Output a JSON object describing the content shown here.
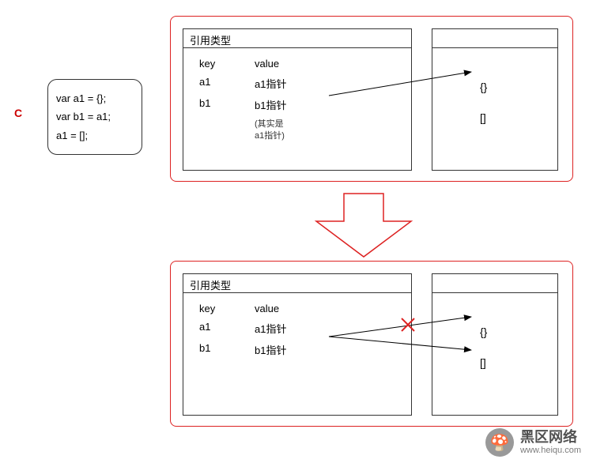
{
  "label": "C",
  "code": {
    "line1": "var a1 = {};",
    "line2": "var b1 = a1;",
    "line3": "a1 = [];"
  },
  "panel1": {
    "ref_title": "引用类型",
    "heap_title": "",
    "header_key": "key",
    "header_val": "value",
    "row1_key": "a1",
    "row1_val": "a1指针",
    "row2_key": "b1",
    "row2_val": "b1指针",
    "note1": "(其实是",
    "note2": "a1指针)",
    "heap_obj": "{}",
    "heap_arr": "[]"
  },
  "panel2": {
    "ref_title": "引用类型",
    "heap_title": "",
    "header_key": "key",
    "header_val": "value",
    "row1_key": "a1",
    "row1_val": "a1指针",
    "row2_key": "b1",
    "row2_val": "b1指针",
    "heap_obj": "{}",
    "heap_arr": "[]"
  },
  "watermark": {
    "main": "黑区网络",
    "sub": "www.heiqu.com"
  }
}
